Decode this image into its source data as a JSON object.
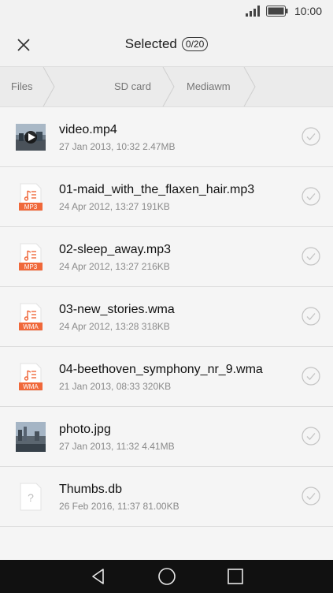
{
  "status": {
    "time": "10:00"
  },
  "header": {
    "title": "Selected",
    "count": "0/20"
  },
  "breadcrumb": [
    {
      "label": "Files"
    },
    {
      "label": "SD card"
    },
    {
      "label": "Mediawm"
    }
  ],
  "files": [
    {
      "name": "video.mp4",
      "date": "27 Jan 2013, 10:32",
      "size": "2.47MB",
      "icon": "video-thumbnail"
    },
    {
      "name": "01-maid_with_the_flaxen_hair.mp3",
      "date": "24 Apr 2012, 13:27",
      "size": "191KB",
      "icon": "audio-file",
      "badge": "MP3"
    },
    {
      "name": "02-sleep_away.mp3",
      "date": "24 Apr 2012, 13:27",
      "size": "216KB",
      "icon": "audio-file",
      "badge": "MP3"
    },
    {
      "name": "03-new_stories.wma",
      "date": "24 Apr 2012, 13:28",
      "size": "318KB",
      "icon": "audio-file",
      "badge": "WMA"
    },
    {
      "name": "04-beethoven_symphony_nr_9.wma",
      "date": "21 Jan 2013, 08:33",
      "size": "320KB",
      "icon": "audio-file",
      "badge": "WMA"
    },
    {
      "name": "photo.jpg",
      "date": "27 Jan 2013, 11:32",
      "size": "4.41MB",
      "icon": "image-thumbnail"
    },
    {
      "name": "Thumbs.db",
      "date": "26 Feb 2016, 11:37",
      "size": "81.00KB",
      "icon": "unknown-file"
    }
  ],
  "colors": {
    "badge": "#f0683a",
    "background": "#f5f5f5",
    "navbar": "#111111"
  }
}
